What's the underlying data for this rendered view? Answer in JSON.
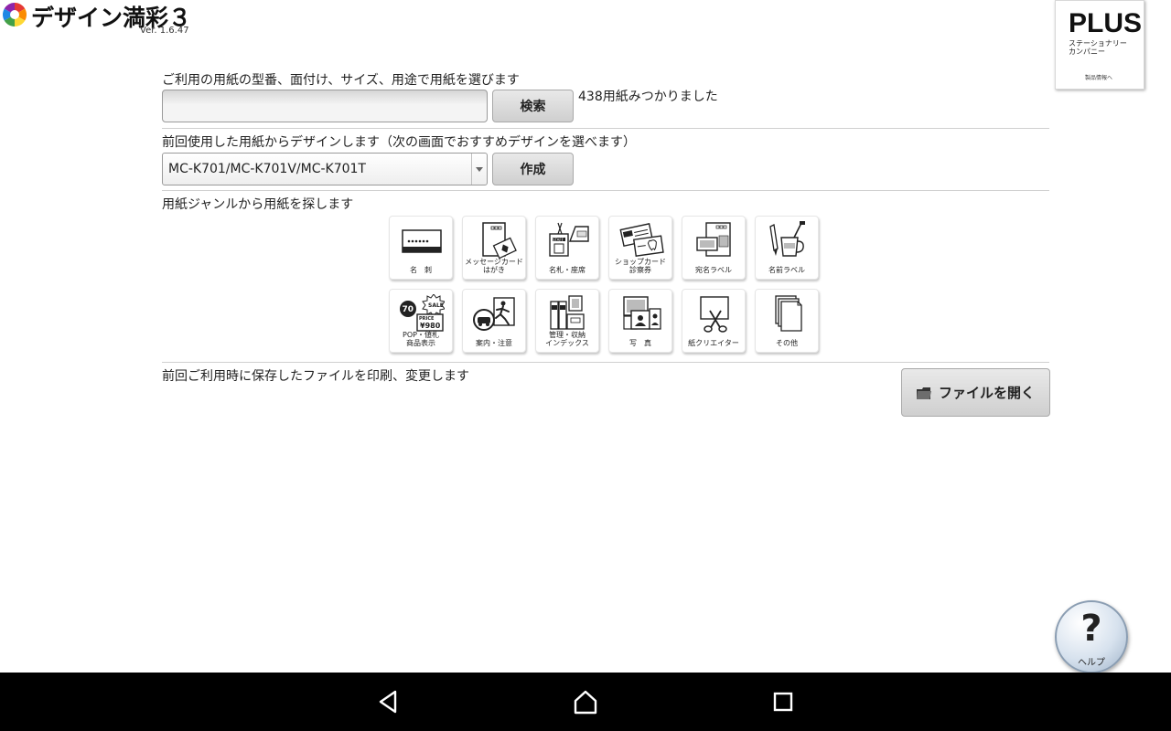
{
  "header": {
    "app_title": "デザイン満彩３",
    "version": "Ver. 1.6.47"
  },
  "brand": {
    "name": "PLUS",
    "line1": "ステーショナリー",
    "line2": "カンパニー",
    "link": "製品情報へ"
  },
  "search_section": {
    "label": "ご利用の用紙の型番、面付け、サイズ、用途で用紙を選びます",
    "input_value": "",
    "search_button": "検索",
    "result_text": "438用紙みつかりました"
  },
  "recent_section": {
    "label": "前回使用した用紙からデザインします（次の画面でおすすめデザインを選べます）",
    "selected_paper": "MC-K701/MC-K701V/MC-K701T",
    "create_button": "作成"
  },
  "genre_section": {
    "label": "用紙ジャンルから用紙を探します",
    "tiles": [
      {
        "label": "名　刺",
        "icon": "business-card-icon"
      },
      {
        "label": "メッセージカード\nはがき",
        "icon": "message-card-icon"
      },
      {
        "label": "名札・座席",
        "icon": "name-tag-icon"
      },
      {
        "label": "ショップカード\n診察券",
        "icon": "shop-card-icon"
      },
      {
        "label": "宛名ラベル",
        "icon": "address-label-icon"
      },
      {
        "label": "名前ラベル",
        "icon": "name-label-icon"
      },
      {
        "label": "POP・値札\n商品表示",
        "icon": "pop-price-tag-icon"
      },
      {
        "label": "案内・注意",
        "icon": "guide-notice-icon"
      },
      {
        "label": "管理・収納\nインデックス",
        "icon": "index-storage-icon"
      },
      {
        "label": "写　真",
        "icon": "photo-icon"
      },
      {
        "label": "紙クリエイター",
        "icon": "paper-creator-icon"
      },
      {
        "label": "その他",
        "icon": "other-icon"
      }
    ],
    "icon_texts": {
      "sale": "SALE",
      "seventy": "70",
      "price": "PRICE",
      "amount": "¥980",
      "staff": "STAFF"
    }
  },
  "file_section": {
    "label": "前回ご利用時に保存したファイルを印刷、変更します",
    "open_button": "ファイルを開く"
  },
  "help": {
    "symbol": "?",
    "label": "ヘルプ"
  },
  "colors": {
    "nav_bar": "#000000",
    "button_gradient_top": "#e9e9e9",
    "button_gradient_bottom": "#cfcfcf"
  }
}
